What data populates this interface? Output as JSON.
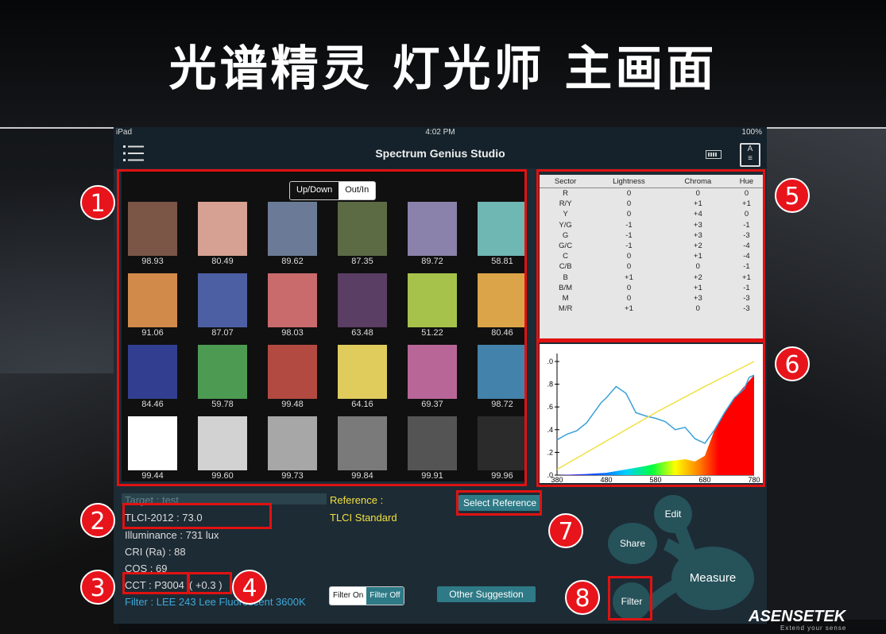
{
  "slide_title": "光谱精灵 灯光师 主画面",
  "watermark": "ASENSETEK",
  "status": {
    "device": "iPad",
    "time": "4:02 PM",
    "battery": "100%"
  },
  "app_title": "Spectrum Genius Studio",
  "segment": {
    "a": "Up/Down",
    "b": "Out/In"
  },
  "swatches": [
    {
      "value": "98.93",
      "color": "#7b5546"
    },
    {
      "value": "80.49",
      "color": "#d6a192"
    },
    {
      "value": "89.62",
      "color": "#6b7b97"
    },
    {
      "value": "87.35",
      "color": "#5c6b44"
    },
    {
      "value": "89.72",
      "color": "#8a82aa"
    },
    {
      "value": "58.81",
      "color": "#6fb7b3"
    },
    {
      "value": "91.06",
      "color": "#d18a4a"
    },
    {
      "value": "87.07",
      "color": "#4d5fa3"
    },
    {
      "value": "98.03",
      "color": "#c96a6c"
    },
    {
      "value": "63.48",
      "color": "#5a3e63"
    },
    {
      "value": "51.22",
      "color": "#a6c24b"
    },
    {
      "value": "80.46",
      "color": "#dca448"
    },
    {
      "value": "84.46",
      "color": "#323f90"
    },
    {
      "value": "59.78",
      "color": "#4d9a52"
    },
    {
      "value": "99.48",
      "color": "#b34a41"
    },
    {
      "value": "64.16",
      "color": "#e0cc5c"
    },
    {
      "value": "69.37",
      "color": "#b86697"
    },
    {
      "value": "98.72",
      "color": "#4383ab"
    },
    {
      "value": "99.44",
      "color": "#ffffff"
    },
    {
      "value": "99.60",
      "color": "#d2d2d2"
    },
    {
      "value": "99.73",
      "color": "#a7a7a7"
    },
    {
      "value": "99.84",
      "color": "#7a7a7a"
    },
    {
      "value": "99.91",
      "color": "#545454"
    },
    {
      "value": "99.96",
      "color": "#2b2b2b"
    }
  ],
  "table": {
    "headers": [
      "Sector",
      "Lightness",
      "Chroma",
      "Hue"
    ],
    "rows": [
      [
        "R",
        "0",
        "0",
        "0"
      ],
      [
        "R/Y",
        "0",
        "+1",
        "+1"
      ],
      [
        "Y",
        "0",
        "+4",
        "0"
      ],
      [
        "Y/G",
        "-1",
        "+3",
        "-1"
      ],
      [
        "G",
        "-1",
        "+3",
        "-3"
      ],
      [
        "G/C",
        "-1",
        "+2",
        "-4"
      ],
      [
        "C",
        "0",
        "+1",
        "-4"
      ],
      [
        "C/B",
        "0",
        "0",
        "-1"
      ],
      [
        "B",
        "+1",
        "+2",
        "+1"
      ],
      [
        "B/M",
        "0",
        "+1",
        "-1"
      ],
      [
        "M",
        "0",
        "+3",
        "-3"
      ],
      [
        "M/R",
        "+1",
        "0",
        "-3"
      ]
    ]
  },
  "chart_data": {
    "type": "line",
    "x_ticks": [
      "380",
      "480",
      "580",
      "680",
      "780"
    ],
    "y_ticks": [
      ".0",
      ".8",
      ".6",
      ".4",
      ".2",
      ".0"
    ],
    "ylim": [
      0,
      1.0
    ],
    "series": [
      {
        "color": "#3aa0d8",
        "x": [
          380,
          400,
          420,
          440,
          460,
          470,
          480,
          500,
          520,
          540,
          560,
          580,
          600,
          620,
          640,
          660,
          680,
          700,
          720,
          740,
          760,
          770,
          780
        ],
        "y": [
          0.31,
          0.36,
          0.39,
          0.46,
          0.58,
          0.64,
          0.68,
          0.78,
          0.72,
          0.55,
          0.52,
          0.5,
          0.47,
          0.4,
          0.42,
          0.32,
          0.28,
          0.4,
          0.55,
          0.68,
          0.76,
          0.86,
          0.88
        ]
      },
      {
        "color": "#f0e040",
        "x": [
          380,
          480,
          580,
          680,
          780
        ],
        "y": [
          0.05,
          0.3,
          0.55,
          0.78,
          1.0
        ]
      }
    ],
    "area": {
      "color": "#ff0000",
      "x": [
        380,
        440,
        480,
        520,
        560,
        600,
        640,
        660,
        680,
        700,
        720,
        740,
        760,
        780
      ],
      "y": [
        0.0,
        0.01,
        0.02,
        0.05,
        0.08,
        0.12,
        0.14,
        0.12,
        0.17,
        0.4,
        0.55,
        0.68,
        0.78,
        0.88
      ]
    }
  },
  "info": {
    "target": "Target : test",
    "tlci": "TLCI-2012 : 73.0",
    "illuminance": "Illuminance : 731 lux",
    "cri": "CRI (Ra) : 88",
    "cqs": "CQS : 69",
    "cct": "CCT : P3004",
    "cct_delta": "( +0.3 )",
    "filter": "Filter : LEE 243 Lee Fluorescent 3600K",
    "reference_label": "Reference :",
    "reference_value": "TLCI Standard"
  },
  "buttons": {
    "select_reference": "Select Reference",
    "filter_on": "Filter On",
    "filter_off": "Filter Off",
    "other_suggestion": "Other Suggestion",
    "edit": "Edit",
    "share": "Share",
    "measure": "Measure",
    "filter": "Filter"
  },
  "badges": [
    "1",
    "2",
    "3",
    "4",
    "5",
    "6",
    "7",
    "8"
  ],
  "logo": {
    "name": "ASENSETEK",
    "tagline": "Extend your sense"
  }
}
